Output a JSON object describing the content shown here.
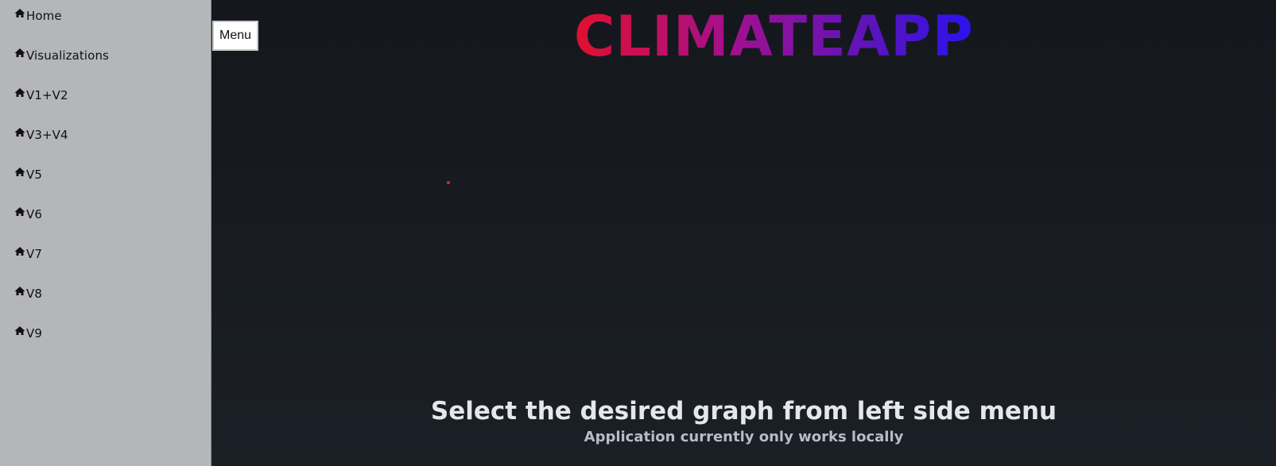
{
  "sidebar": {
    "items": [
      {
        "label": "Home",
        "icon": "home-icon"
      },
      {
        "label": "Visualizations",
        "icon": "home-icon"
      },
      {
        "label": "V1+V2",
        "icon": "home-icon"
      },
      {
        "label": "V3+V4",
        "icon": "home-icon"
      },
      {
        "label": "V5",
        "icon": "home-icon"
      },
      {
        "label": "V6",
        "icon": "home-icon"
      },
      {
        "label": "V7",
        "icon": "home-icon"
      },
      {
        "label": "V8",
        "icon": "home-icon"
      },
      {
        "label": "V9",
        "icon": "home-icon"
      }
    ]
  },
  "menu_button": {
    "label": "Menu"
  },
  "header": {
    "logo_text": "CLIMATEAPP",
    "logo_colors": [
      "#e20f2e",
      "#a1108f",
      "#5a14bd",
      "#2a12ef"
    ]
  },
  "main": {
    "headline": "Select the desired graph from left side menu",
    "subline": "Application currently only works locally"
  },
  "colors": {
    "sidebar_bg": "#b5b6b9",
    "page_bg": "#1b1f26",
    "headline": "#e6e7ea",
    "subline": "#b8bcc4",
    "dot": "#d62828"
  }
}
